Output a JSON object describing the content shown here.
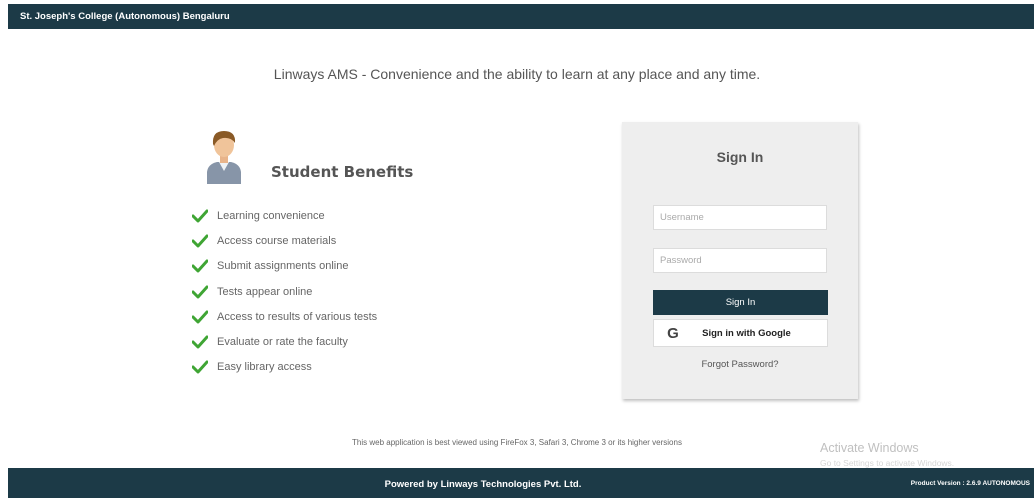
{
  "header": {
    "title": "St. Joseph's College (Autonomous) Bengaluru"
  },
  "tagline": "Linways AMS - Convenience and the ability to learn at any place and any time.",
  "benefits": {
    "heading": "Student Benefits",
    "items": [
      {
        "label": "Learning convenience"
      },
      {
        "label": "Access course materials"
      },
      {
        "label": "Submit assignments online"
      },
      {
        "label": "Tests appear online"
      },
      {
        "label": "Access to results of various tests"
      },
      {
        "label": "Evaluate or rate the faculty"
      },
      {
        "label": "Easy library access"
      }
    ]
  },
  "signin": {
    "title": "Sign In",
    "username_placeholder": "Username",
    "password_placeholder": "Password",
    "signin_label": "Sign In",
    "google_label": "Sign in with Google",
    "forgot_label": "Forgot Password?"
  },
  "note": "This web application is best viewed using FireFox 3, Safari 3, Chrome 3 or its higher versions",
  "watermark": {
    "title": "Activate Windows",
    "subtitle": "Go to Settings to activate Windows."
  },
  "footer": {
    "text": "Powered by Linways Technologies Pvt. Ltd.",
    "version": "Product Version : 2.6.9 AUTONOMOUS"
  },
  "colors": {
    "primary": "#1c3a47",
    "check": "#3fa534",
    "card": "#eeeeee"
  },
  "icons": {
    "avatar": "student-avatar-icon",
    "check": "checkmark-icon",
    "google": "google-icon"
  }
}
